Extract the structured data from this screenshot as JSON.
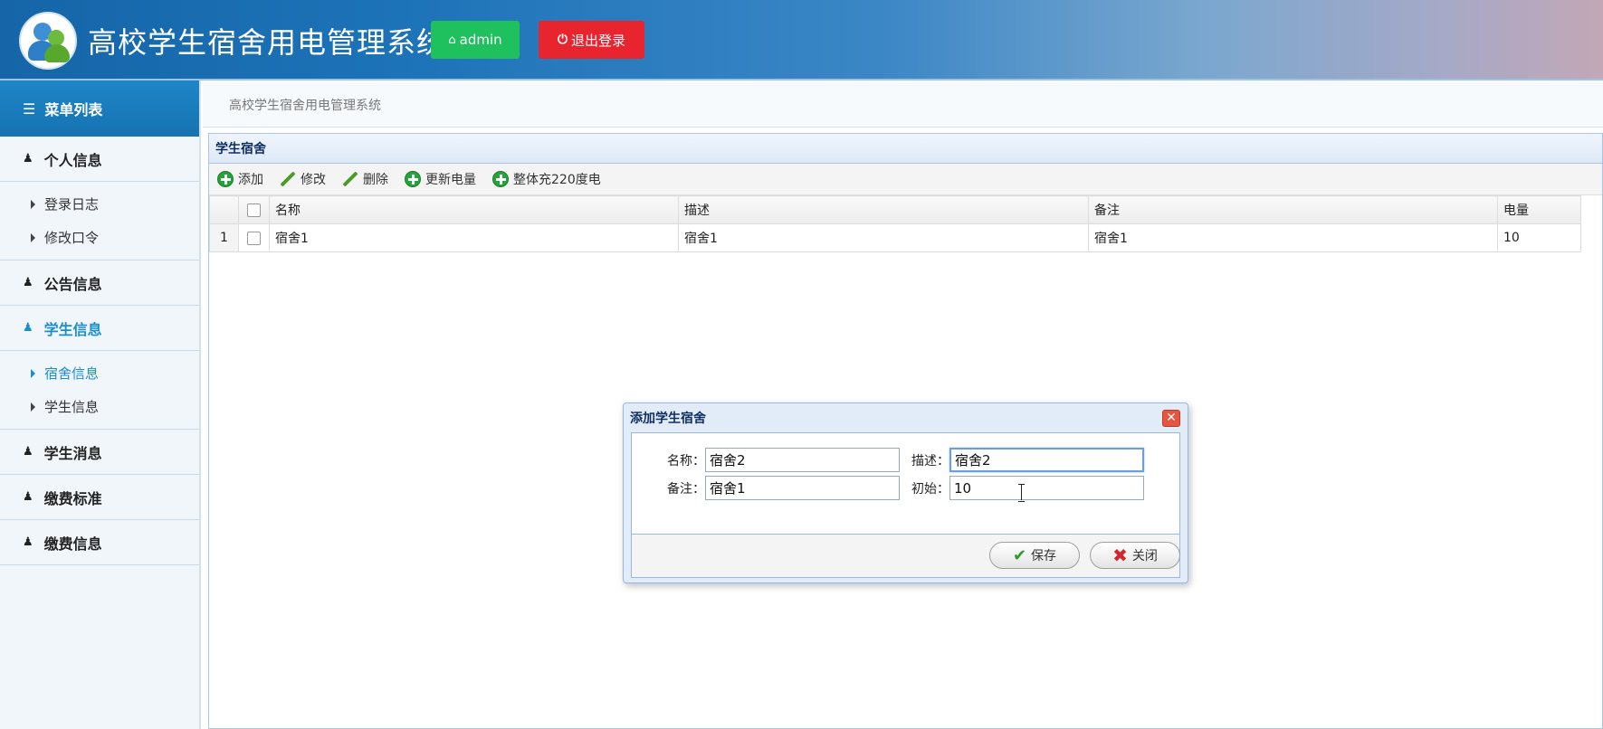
{
  "header": {
    "title": "高校学生宿舍用电管理系统",
    "admin_label": "admin",
    "logout_label": "退出登录",
    "admin_color": "#1fc05e",
    "logout_color": "#e8252e"
  },
  "sidebar": {
    "menu_title": "菜单列表",
    "groups": [
      {
        "label": "个人信息",
        "items": [
          "登录日志",
          "修改口令"
        ]
      },
      {
        "label": "公告信息"
      },
      {
        "label": "学生信息",
        "active": true,
        "items": [
          "宿舍信息",
          "学生信息"
        ],
        "active_item": "宿舍信息"
      },
      {
        "label": "学生消息"
      },
      {
        "label": "缴费标准"
      },
      {
        "label": "缴费信息"
      }
    ],
    "accent": "#1a8fd0"
  },
  "breadcrumb": "高校学生宿舍用电管理系统",
  "panel": {
    "title": "学生宿舍",
    "toolbar": {
      "add": "添加",
      "edit": "修改",
      "delete": "删除",
      "update_power": "更新电量",
      "charge_all": "整体充220度电"
    },
    "columns": [
      "名称",
      "描述",
      "备注",
      "电量"
    ],
    "rows": [
      {
        "num": "1",
        "name": "宿舍1",
        "desc": "宿舍1",
        "note": "宿舍1",
        "power": "10"
      }
    ]
  },
  "dialog": {
    "title": "添加学生宿舍",
    "name_label": "名称：",
    "name_value": "宿舍2",
    "desc_label": "描述：",
    "desc_value": "宿舍2",
    "note_label": "备注：",
    "note_value": "宿舍1",
    "init_label": "初始：",
    "init_value": "10",
    "save_label": "保存",
    "close_label": "关闭"
  }
}
